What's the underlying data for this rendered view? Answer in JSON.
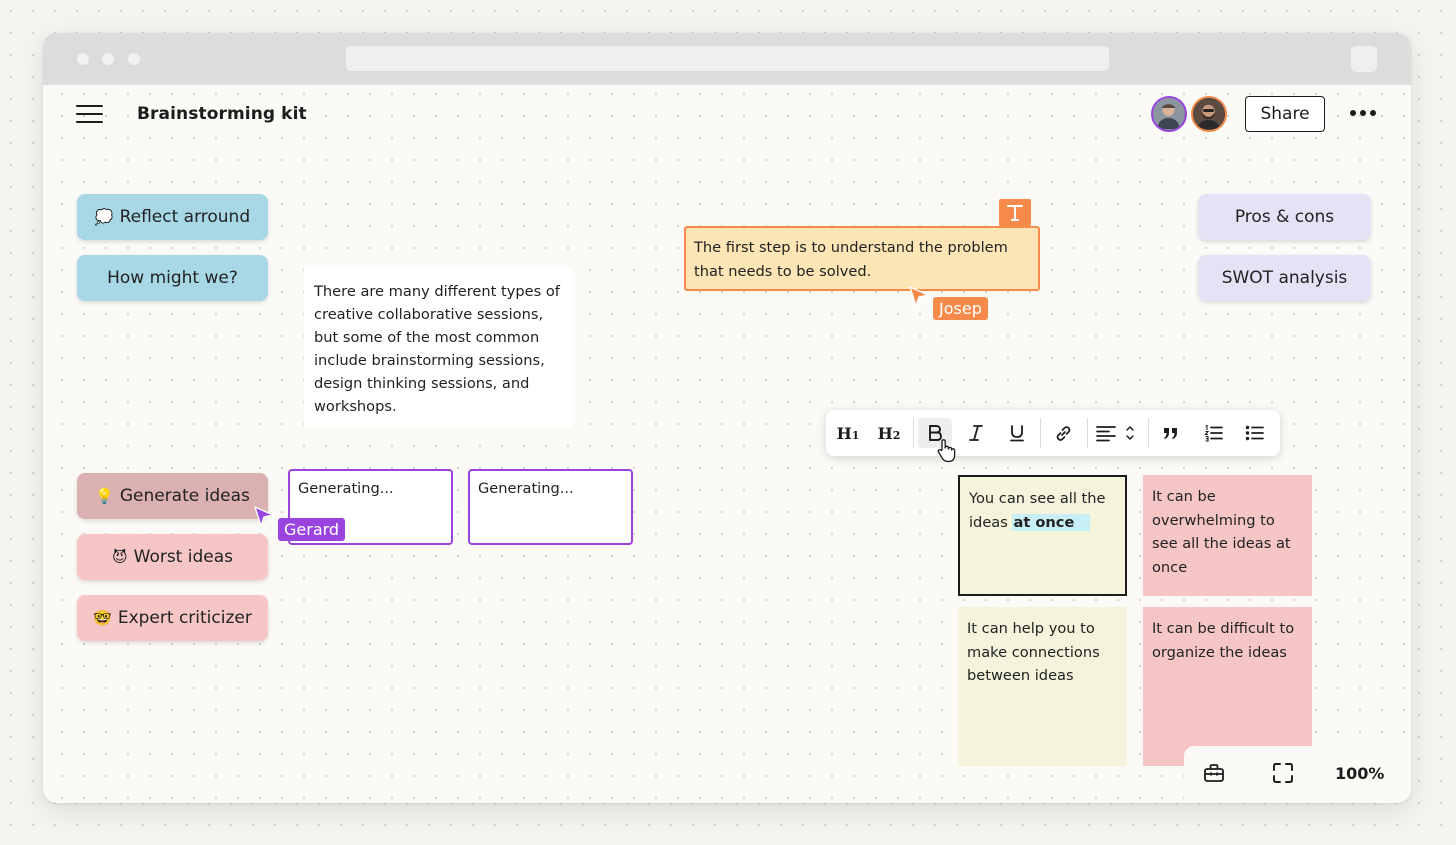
{
  "app": {
    "title": "Brainstorming kit",
    "share_label": "Share",
    "zoom": "100%"
  },
  "colors": {
    "accent_purple": "#9a44e0",
    "accent_orange": "#f58a4b",
    "chip_blue": "#a8d8e6",
    "chip_lavender": "#e4e3f6",
    "chip_rose": "#dbb0b0",
    "chip_pink": "#f6c6c6",
    "sticky_yellow": "#f4f4dc"
  },
  "left_chips": [
    {
      "emoji": "💭",
      "label": "Reflect arround"
    },
    {
      "emoji": "",
      "label": "How might we?"
    },
    {
      "emoji": "💡",
      "label": "Generate ideas"
    },
    {
      "emoji": "😈",
      "label": "Worst ideas"
    },
    {
      "emoji": "🤓",
      "label": "Expert criticizer"
    }
  ],
  "right_chips": [
    {
      "label": "Pros & cons"
    },
    {
      "label": "SWOT analysis"
    }
  ],
  "text_card": "There are many different types of creative collaborative sessions, but some of the most common include brainstorming sessions, design thinking sessions, and workshops.",
  "generating_boxes": [
    "Generating...",
    "Generating..."
  ],
  "cursors": {
    "gerard": "Gerard",
    "josep": "Josep"
  },
  "orange_note": "The first step is to understand the problem that needs to be solved.",
  "text_badge_icon": "text-tool-icon",
  "toolbar": {
    "h1": "H",
    "h1_sub": "1",
    "h2": "H",
    "h2_sub": "2",
    "icons": [
      "bold-icon",
      "italic-icon",
      "underline-icon",
      "link-icon",
      "align-left-icon",
      "quote-icon",
      "ordered-list-icon",
      "bullet-list-icon"
    ]
  },
  "stickies": {
    "pro1_plain": "You can see all the ideas ",
    "pro1_bold": "at once",
    "con1": "It can be overwhelming to see all the ideas at once",
    "pro2": "It can help you to make connections between ideas",
    "con2": "It can be difficult to organize the ideas"
  }
}
